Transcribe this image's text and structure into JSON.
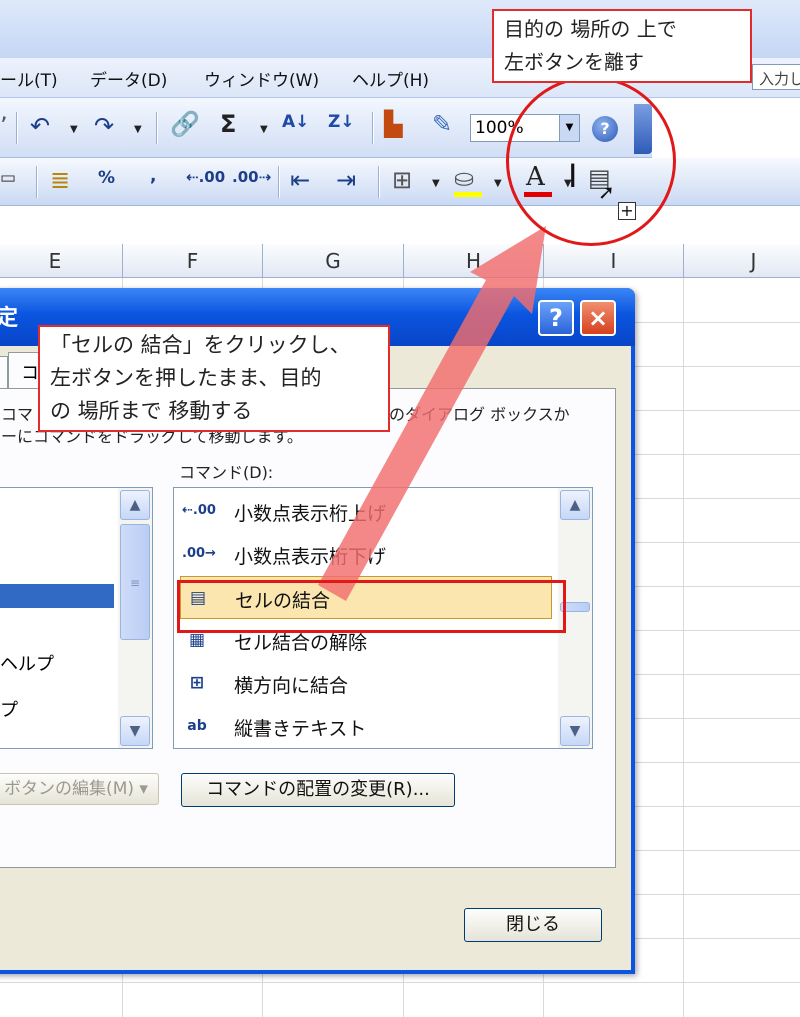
{
  "menu": {
    "items": [
      "ール(T)",
      "データ(D)",
      "ウィンドウ(W)",
      "ヘルプ(H)"
    ],
    "help_placeholder": "入力し"
  },
  "toolbar": {
    "zoom": "100%"
  },
  "sheet": {
    "columns": [
      "E",
      "F",
      "G",
      "H",
      "I",
      "J"
    ]
  },
  "dialog": {
    "title": "定",
    "help_button": "?",
    "close_button": "×",
    "tab_fragment": "コ",
    "description_line1": "コマ",
    "description_line1_right": "のダイアログ ボックスか",
    "description_line2": "ーにコマンドをドラッグして移動します。",
    "commands_label": "コマンド(D):",
    "categories_visible": [
      "ヘルプ",
      "プ"
    ],
    "commands": [
      {
        "icon": "⇠.00",
        "label": "小数点表示桁上げ"
      },
      {
        "icon": ".00→",
        "label": "小数点表示桁下げ"
      },
      {
        "icon": "▤",
        "label": "セルの結合"
      },
      {
        "icon": "▦",
        "label": "セル結合の解除"
      },
      {
        "icon": "⊞",
        "label": "横方向に結合"
      },
      {
        "icon": "ab",
        "label": "縦書きテキスト"
      }
    ],
    "edit_button": "ボタンの編集(M) ▾",
    "rearrange_button": "コマンドの配置の変更(R)...",
    "close_label": "閉じる"
  },
  "annotations": {
    "top_callout": [
      "目的の 場所の 上で",
      "左ボタンを離す"
    ],
    "mid_callout": [
      "「セルの 結合」をクリックし、",
      "左ボタンを押したまま、目的",
      "の 場所まで 移動する"
    ]
  },
  "colors": {
    "accent_red": "#e01818",
    "dialog_blue": "#0a55e3",
    "selection": "#fbe6b0"
  }
}
